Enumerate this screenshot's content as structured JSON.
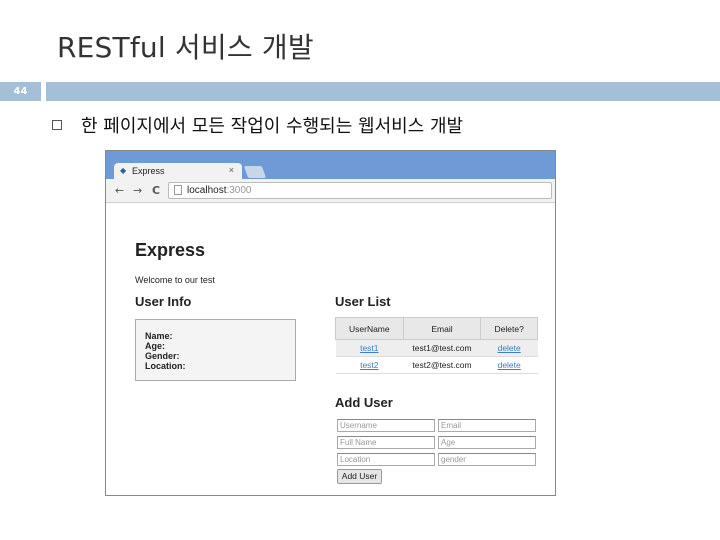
{
  "slide": {
    "title": "RESTful 서비스 개발",
    "number": "44",
    "bullet": "한 페이지에서 모든 작업이 수행되는 웹서비스 개발"
  },
  "browser": {
    "tab_title": "Express",
    "tab_close": "×",
    "url_host": "localhost",
    "url_port": ":3000",
    "back_glyph": "←",
    "forward_glyph": "→",
    "reload_glyph": "C"
  },
  "app": {
    "heading": "Express",
    "welcome": "Welcome to our test",
    "user_info": {
      "heading": "User Info",
      "name_label": "Name:",
      "age_label": "Age:",
      "gender_label": "Gender:",
      "location_label": "Location:"
    },
    "user_list": {
      "heading": "User List",
      "columns": [
        "UserName",
        "Email",
        "Delete?"
      ],
      "rows": [
        {
          "username": "test1",
          "email": "test1@test.com",
          "delete": "delete"
        },
        {
          "username": "test2",
          "email": "test2@test.com",
          "delete": "delete"
        }
      ]
    },
    "add_user": {
      "heading": "Add User",
      "placeholders": {
        "username": "Username",
        "email": "Email",
        "fullname": "Full Name",
        "age": "Age",
        "location": "Location",
        "gender": "gender"
      },
      "button": "Add User"
    }
  },
  "colors": {
    "header_bar": "#a4bfd8",
    "chrome_frame": "#6f9ad6",
    "link": "#3b7ec6"
  }
}
